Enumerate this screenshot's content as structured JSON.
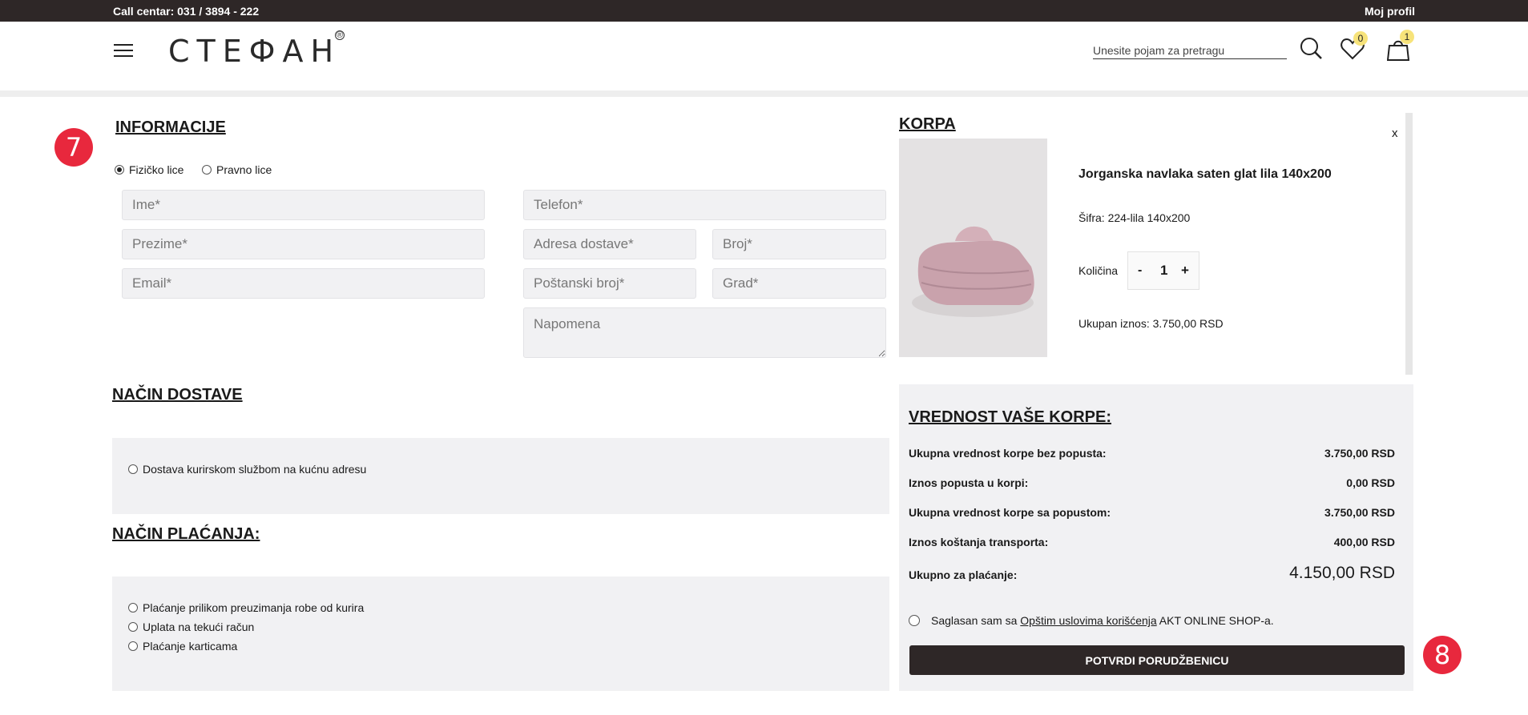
{
  "topbar": {
    "call_center": "Call centar: 031 / 3894 - 222",
    "profile": "Moj profil"
  },
  "header": {
    "logo": "СТЕФАН",
    "logo_mark": "®",
    "search_placeholder": "Unesite pojam za pretragu",
    "wishlist_count": "0",
    "cart_count": "1"
  },
  "steps": {
    "info_step": "7",
    "confirm_step": "8"
  },
  "info": {
    "title": "INFORMACIJE",
    "person_type": [
      {
        "label": "Fizičko lice",
        "selected": true
      },
      {
        "label": "Pravno lice",
        "selected": false
      }
    ],
    "fields": {
      "first_name": "Ime*",
      "last_name": "Prezime*",
      "email": "Email*",
      "phone": "Telefon*",
      "address": "Adresa dostave*",
      "number": "Broj*",
      "postal": "Poštanski broj*",
      "city": "Grad*",
      "note": "Napomena"
    }
  },
  "delivery": {
    "title": "NAČIN DOSTAVE",
    "options": [
      "Dostava kurirskom službom na kućnu adresu"
    ]
  },
  "payment": {
    "title": "NAČIN PLAĆANJA:",
    "options": [
      "Plaćanje prilikom preuzimanja robe od kurira",
      "Uplata na tekući račun",
      "Plaćanje karticama"
    ]
  },
  "cart": {
    "title": "KORPA",
    "close": "x",
    "item": {
      "name": "Jorganska navlaka saten glat lila 140x200",
      "sku": "Šifra: 224-lila 140x200",
      "qty_label": "Količina",
      "qty_minus": "-",
      "qty": "1",
      "qty_plus": "+",
      "total": "Ukupan iznos: 3.750,00 RSD"
    }
  },
  "summary": {
    "title": "VREDNOST VAŠE KORPE:",
    "rows": [
      {
        "label": "Ukupna vrednost korpe bez popusta:",
        "value": "3.750,00 RSD"
      },
      {
        "label": "Iznos popusta u korpi:",
        "value": "0,00 RSD"
      },
      {
        "label": "Ukupna vrednost korpe sa popustom:",
        "value": "3.750,00 RSD"
      },
      {
        "label": "Iznos koštanja transporta:",
        "value": "400,00 RSD"
      }
    ],
    "total_label": "Ukupno za plaćanje:",
    "total_value": "4.150,00 RSD",
    "terms_prefix": "Saglasan sam sa ",
    "terms_link": "Opštim uslovima korišćenja",
    "terms_suffix": " AKT ONLINE SHOP-a.",
    "confirm_button": "POTVRDI PORUDŽBENICU"
  },
  "colors": {
    "dark": "#2e2727",
    "accent_red": "#e8283d",
    "badge": "#f7e37a",
    "panel": "#f1f1f3"
  }
}
